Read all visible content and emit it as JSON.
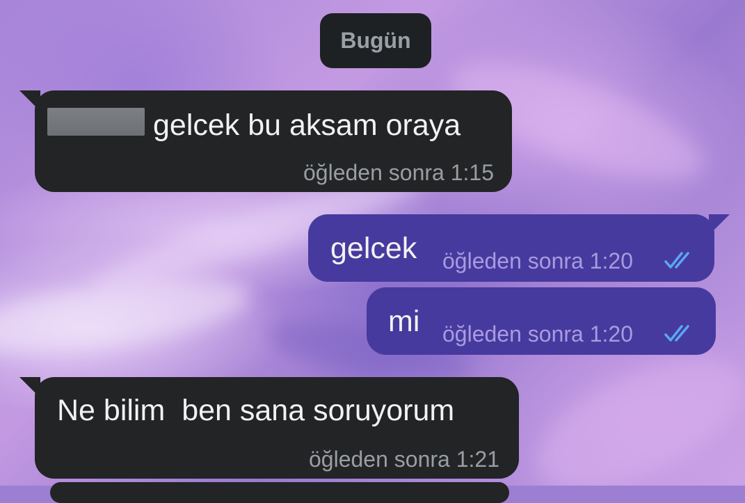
{
  "chat": {
    "date_separator": "Bugün",
    "messages": [
      {
        "direction": "incoming",
        "text": "gelcek bu aksam oraya",
        "time": "öğleden sonra 1:15",
        "has_redacted_name": true
      },
      {
        "direction": "outgoing",
        "text": "gelcek",
        "time": "öğleden sonra 1:20",
        "status": "read-double-check"
      },
      {
        "direction": "outgoing",
        "text": "mi",
        "time": "öğleden sonra 1:20",
        "status": "read-double-check"
      },
      {
        "direction": "incoming",
        "text": "Ne bilim  ben sana soruyorum",
        "time": "öğleden sonra 1:21"
      }
    ]
  },
  "colors": {
    "incoming_bubble": "#222426",
    "outgoing_bubble": "#473a9e",
    "read_ticks": "#5aa7f5",
    "date_chip": "#1e2124"
  }
}
